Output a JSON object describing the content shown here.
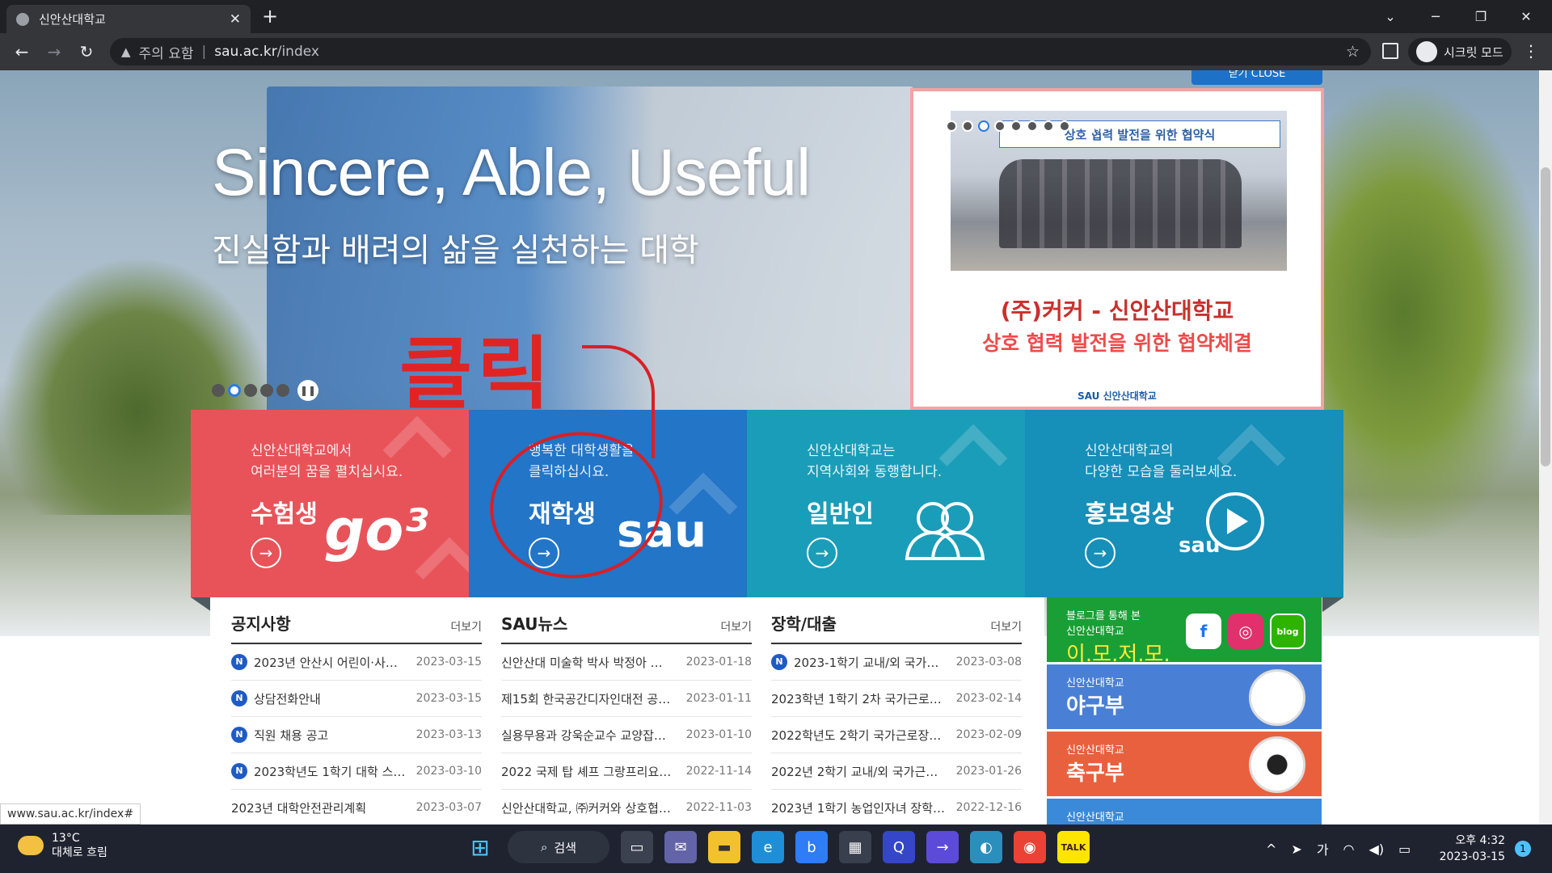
{
  "browser": {
    "tab_title": "신안산대학교",
    "close_tab": "✕",
    "new_tab": "+",
    "security_label": "주의 요함",
    "url_host": "sau.ac.kr",
    "url_path": "/index",
    "incognito_label": "시크릿 모드"
  },
  "hero": {
    "slogan": "Sincere, Able, Useful",
    "subtitle": "진실함과 배려의 삶을 실천하는 대학",
    "annotation": "클릭",
    "popup_close": "닫기 CLOSE"
  },
  "popup": {
    "banner": "상호 협력 발전을 위한 협약식",
    "line1": "(주)커커 - 신안산대학교",
    "line2": "상호 협력 발전을 위한 협약체결",
    "logo": "SAU 신안산대학교"
  },
  "tiles": [
    {
      "line1": "신안산대학교에서",
      "line2": "여러분의 꿈을 펼치십시요.",
      "heading": "수험생",
      "graphic": "go³"
    },
    {
      "line1": "행복한 대학생활을",
      "line2": "클릭하십시요.",
      "heading": "재학생",
      "graphic": "sau"
    },
    {
      "line1": "신안산대학교는",
      "line2": "지역사회와 동행합니다.",
      "heading": "일반인",
      "graphic": "people-icon"
    },
    {
      "line1": "신안산대학교의",
      "line2": "다양한 모습을 둘러보세요.",
      "heading": "홍보영상",
      "graphic": "play-icon"
    }
  ],
  "boards": [
    {
      "title": "공지사항",
      "more": "더보기",
      "rows": [
        {
          "badge": "N",
          "text": "2023년 안산시 어린이·사…",
          "date": "2023-03-15"
        },
        {
          "badge": "N",
          "text": "상담전화안내",
          "date": "2023-03-15"
        },
        {
          "badge": "N",
          "text": "직원 채용 공고",
          "date": "2023-03-13"
        },
        {
          "badge": "N",
          "text": "2023학년도 1학기 대학 스…",
          "date": "2023-03-10"
        },
        {
          "badge": "",
          "text": "2023년 대학안전관리계획",
          "date": "2023-03-07"
        }
      ]
    },
    {
      "title": "SAU뉴스",
      "more": "더보기",
      "rows": [
        {
          "badge": "",
          "text": "신안산대 미술학 박사 박정아 …",
          "date": "2023-01-18"
        },
        {
          "badge": "",
          "text": "제15회 한국공간디자인대전 공…",
          "date": "2023-01-11"
        },
        {
          "badge": "",
          "text": "실용무용과 강욱순교수 교양잡…",
          "date": "2023-01-10"
        },
        {
          "badge": "",
          "text": "2022 국제 탑 셰프 그랑프리요…",
          "date": "2022-11-14"
        },
        {
          "badge": "",
          "text": "신안산대학교, ㈜커커와 상호협…",
          "date": "2022-11-03"
        }
      ]
    },
    {
      "title": "장학/대출",
      "more": "더보기",
      "rows": [
        {
          "badge": "N",
          "text": "2023-1학기 교내/외 국가…",
          "date": "2023-03-08"
        },
        {
          "badge": "",
          "text": "2023학년 1학기 2차 국가근로…",
          "date": "2023-02-14"
        },
        {
          "badge": "",
          "text": "2022학년도 2학기 국가근로장…",
          "date": "2023-02-09"
        },
        {
          "badge": "",
          "text": "2022년 2학기 교내/외 국가근…",
          "date": "2023-01-26"
        },
        {
          "badge": "",
          "text": "2023년 1학기 농업인자녀 장학…",
          "date": "2022-12-16"
        }
      ]
    }
  ],
  "sidebar": {
    "blog_small1": "블로그를 통해 본",
    "blog_small2": "신안산대학교",
    "blog_large": "이.모.저.모.",
    "baseball_small": "신안산대학교",
    "baseball_large": "야구부",
    "soccer_small": "신안산대학교",
    "soccer_large": "축구부",
    "fourth_small": "신안산대학교"
  },
  "statusbar": {
    "url": "www.sau.ac.kr/index#"
  },
  "taskbar": {
    "temperature": "13°C",
    "weather": "대체로 흐림",
    "search": "검색",
    "ime": "가",
    "time": "오후 4:32",
    "date": "2023-03-15",
    "notifications": "1"
  },
  "colors": {
    "red_tile": "#e8535a",
    "blue_tile": "#2275c7",
    "teal_tile": "#1a9db8",
    "cyan_tile": "#168fb9",
    "annotation": "#e02424"
  }
}
